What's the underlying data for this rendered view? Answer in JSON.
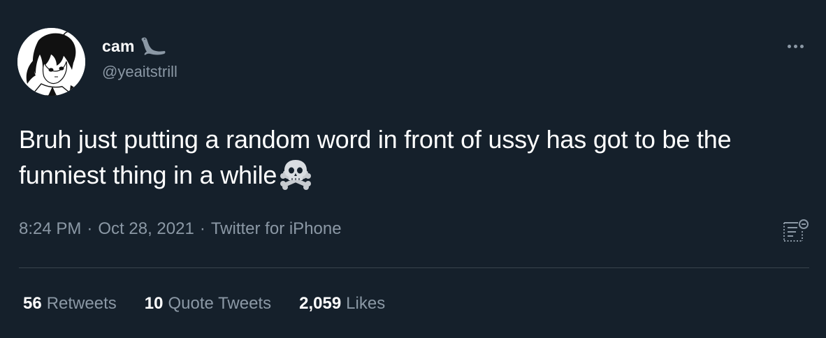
{
  "author": {
    "name": "cam",
    "handle": "@yeaitstrill",
    "name_emoji": "seal-icon",
    "avatar": "anime-character-avatar"
  },
  "tweet": {
    "text": "Bruh just putting a random word in front of ussy has got to be the funniest thing in a while",
    "text_emoji": "skull-and-crossbones-icon"
  },
  "meta": {
    "time": "8:24 PM",
    "separator": "·",
    "date": "Oct 28, 2021",
    "source": "Twitter for iPhone"
  },
  "stats": {
    "retweets_count": "56",
    "retweets_label": "Retweets",
    "quotes_count": "10",
    "quotes_label": "Quote Tweets",
    "likes_count": "2,059",
    "likes_label": "Likes"
  },
  "icons": {
    "more": "more-icon",
    "analytics": "analytics-icon"
  },
  "colors": {
    "background": "#15202b",
    "primary_text": "#ffffff",
    "secondary_text": "#8b98a5",
    "divider": "#38444d"
  }
}
